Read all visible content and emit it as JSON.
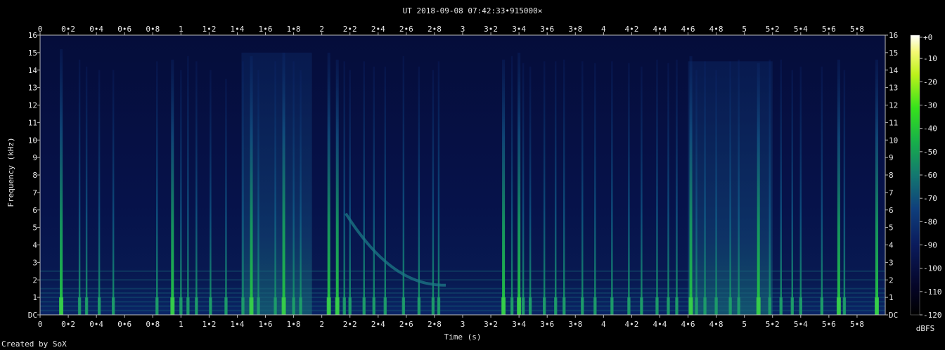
{
  "chart_data": {
    "type": "heatmap",
    "title": "UT 2018-09-08 07:42:33•915000×",
    "xlabel": "Time (s)",
    "ylabel": "Frequency (kHz)",
    "xlim": [
      0,
      6
    ],
    "ylim": [
      0,
      16
    ],
    "x_ticks": [
      "0",
      "0•2",
      "0•4",
      "0•6",
      "0•8",
      "1",
      "1•2",
      "1•4",
      "1•6",
      "1•8",
      "2",
      "2•2",
      "2•4",
      "2•6",
      "2•8",
      "3",
      "3•2",
      "3•4",
      "3•6",
      "3•8",
      "4",
      "4•2",
      "4•4",
      "4•6",
      "4•8",
      "5",
      "5•2",
      "5•4",
      "5•6",
      "5•8"
    ],
    "y_ticks": [
      "DC",
      "1",
      "2",
      "3",
      "4",
      "5",
      "6",
      "7",
      "8",
      "9",
      "10",
      "11",
      "12",
      "13",
      "14",
      "15",
      "16"
    ],
    "colorbar": {
      "label": "dBFS",
      "ticks": [
        "+0",
        "-10",
        "-20",
        "-30",
        "-40",
        "-50",
        "-60",
        "-70",
        "-80",
        "-90",
        "-100",
        "-110",
        "-120"
      ],
      "range": [
        -120,
        0
      ]
    },
    "events": [
      {
        "t": 0.15,
        "f_max": 15.2,
        "level": -50
      },
      {
        "t": 0.28,
        "f_max": 14.6,
        "level": -75
      },
      {
        "t": 0.33,
        "f_max": 14.2,
        "level": -75
      },
      {
        "t": 0.42,
        "f_max": 14.0,
        "level": -78
      },
      {
        "t": 0.52,
        "f_max": 14.0,
        "level": -72
      },
      {
        "t": 0.83,
        "f_max": 14.5,
        "level": -62
      },
      {
        "t": 0.94,
        "f_max": 14.6,
        "level": -55
      },
      {
        "t": 1.0,
        "f_max": 14.0,
        "level": -72
      },
      {
        "t": 1.05,
        "f_max": 14.8,
        "level": -65
      },
      {
        "t": 1.11,
        "f_max": 14.5,
        "level": -75
      },
      {
        "t": 1.21,
        "f_max": 14.0,
        "level": -70
      },
      {
        "t": 1.32,
        "f_max": 13.5,
        "level": -80
      },
      {
        "t": 1.44,
        "f_max": 14.5,
        "level": -68
      },
      {
        "t": 1.5,
        "f_max": 14.8,
        "level": -50
      },
      {
        "t": 1.55,
        "f_max": 14.0,
        "level": -72
      },
      {
        "t": 1.67,
        "f_max": 14.5,
        "level": -68
      },
      {
        "t": 1.73,
        "f_max": 15.0,
        "level": -58
      },
      {
        "t": 1.8,
        "f_max": 14.5,
        "level": -72
      },
      {
        "t": 1.85,
        "f_max": 14.0,
        "level": -75
      },
      {
        "t": 2.05,
        "f_max": 15.0,
        "level": -56
      },
      {
        "t": 2.11,
        "f_max": 14.6,
        "level": -60
      },
      {
        "t": 2.16,
        "f_max": 14.5,
        "level": -65
      },
      {
        "t": 2.2,
        "f_max": 14.0,
        "level": -72
      },
      {
        "t": 2.3,
        "f_max": 14.5,
        "level": -72
      },
      {
        "t": 2.37,
        "f_max": 14.2,
        "level": -72
      },
      {
        "t": 2.45,
        "f_max": 14.2,
        "level": -62
      },
      {
        "t": 2.58,
        "f_max": 14.8,
        "level": -66
      },
      {
        "t": 2.69,
        "f_max": 14.2,
        "level": -72
      },
      {
        "t": 2.79,
        "f_max": 14.0,
        "level": -74
      },
      {
        "t": 2.83,
        "f_max": 14.5,
        "level": -70
      },
      {
        "t": 3.29,
        "f_max": 14.6,
        "level": -60
      },
      {
        "t": 3.35,
        "f_max": 14.8,
        "level": -65
      },
      {
        "t": 3.4,
        "f_max": 15.0,
        "level": -56
      },
      {
        "t": 3.43,
        "f_max": 14.4,
        "level": -68
      },
      {
        "t": 3.48,
        "f_max": 14.2,
        "level": -72
      },
      {
        "t": 3.58,
        "f_max": 14.5,
        "level": -66
      },
      {
        "t": 3.66,
        "f_max": 14.5,
        "level": -70
      },
      {
        "t": 3.72,
        "f_max": 14.6,
        "level": -64
      },
      {
        "t": 3.85,
        "f_max": 14.5,
        "level": -70
      },
      {
        "t": 3.94,
        "f_max": 14.4,
        "level": -66
      },
      {
        "t": 4.06,
        "f_max": 14.5,
        "level": -68
      },
      {
        "t": 4.18,
        "f_max": 14.4,
        "level": -68
      },
      {
        "t": 4.27,
        "f_max": 14.2,
        "level": -72
      },
      {
        "t": 4.38,
        "f_max": 14.6,
        "level": -66
      },
      {
        "t": 4.46,
        "f_max": 14.4,
        "level": -72
      },
      {
        "t": 4.52,
        "f_max": 14.6,
        "level": -70
      },
      {
        "t": 4.62,
        "f_max": 14.8,
        "level": -58
      },
      {
        "t": 4.66,
        "f_max": 14.0,
        "level": -70
      },
      {
        "t": 4.72,
        "f_max": 14.5,
        "level": -68
      },
      {
        "t": 4.8,
        "f_max": 14.0,
        "level": -72
      },
      {
        "t": 4.9,
        "f_max": 14.5,
        "level": -70
      },
      {
        "t": 4.96,
        "f_max": 14.6,
        "level": -66
      },
      {
        "t": 5.1,
        "f_max": 14.4,
        "level": -60
      },
      {
        "t": 5.18,
        "f_max": 14.6,
        "level": -66
      },
      {
        "t": 5.26,
        "f_max": 14.6,
        "level": -66
      },
      {
        "t": 5.34,
        "f_max": 14.0,
        "level": -72
      },
      {
        "t": 5.4,
        "f_max": 14.2,
        "level": -72
      },
      {
        "t": 5.55,
        "f_max": 14.2,
        "level": -72
      },
      {
        "t": 5.67,
        "f_max": 14.6,
        "level": -58
      },
      {
        "t": 5.71,
        "f_max": 14.0,
        "level": -70
      },
      {
        "t": 5.94,
        "f_max": 14.6,
        "level": -56
      }
    ],
    "sweep": {
      "t_start": 2.17,
      "t_end": 2.88,
      "f_start": 5.8,
      "f_end": 1.7,
      "level": -80
    },
    "noise_bands": [
      {
        "t_start": 1.43,
        "t_end": 1.93,
        "f_max": 15.0,
        "level": -88
      },
      {
        "t_start": 4.6,
        "t_end": 5.2,
        "f_max": 14.5,
        "level": -88
      }
    ]
  },
  "footer": {
    "credit": "Created by SoX"
  }
}
